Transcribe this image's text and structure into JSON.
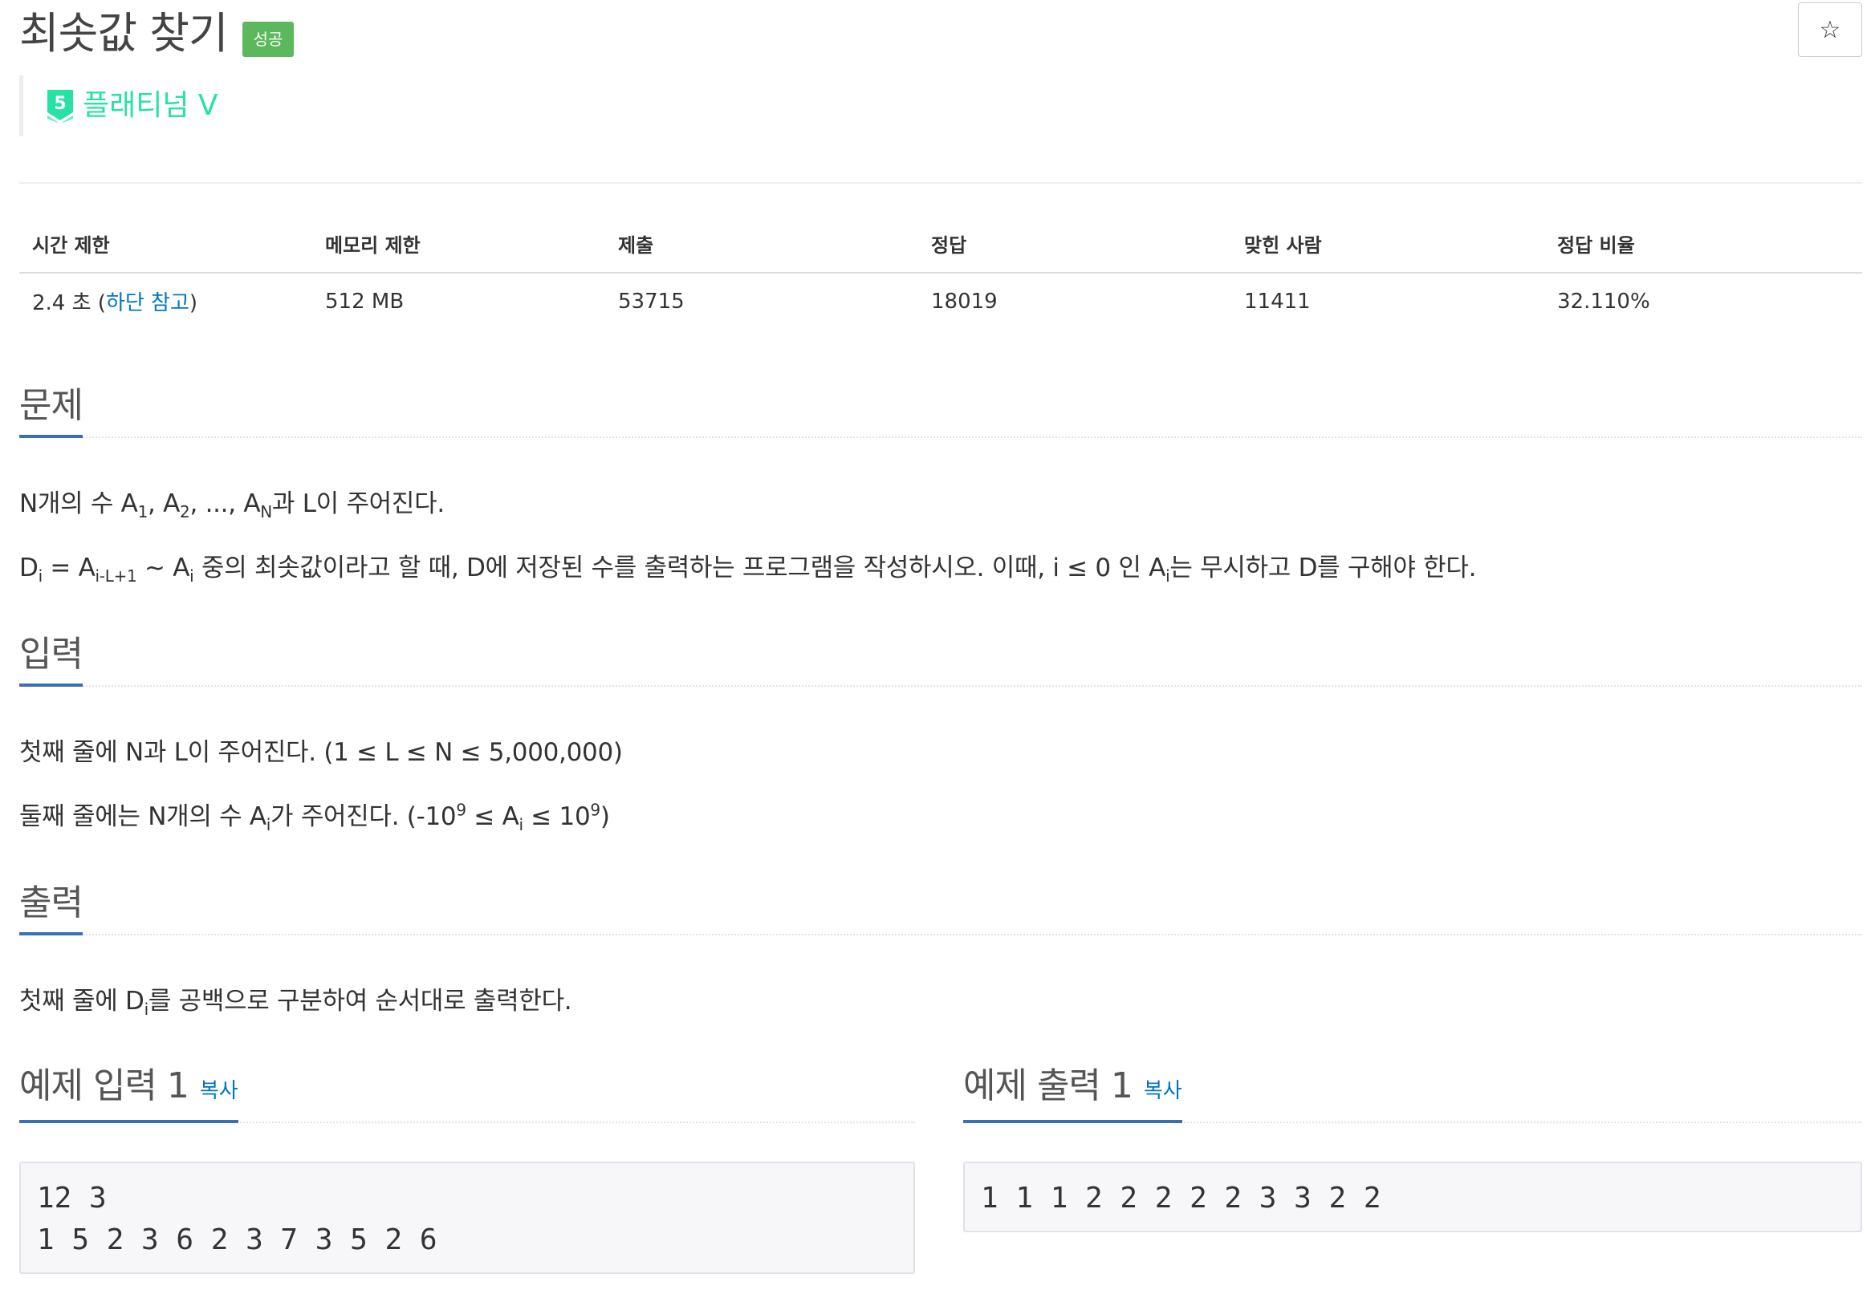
{
  "header": {
    "title": "최솟값 찾기",
    "result_badge": "성공",
    "star_glyph": "☆",
    "tier_number": "5",
    "tier_label": "플래티넘 V",
    "tier_color": "#27e2a4",
    "badge_color": "#5cb85c"
  },
  "info_table": {
    "headers": [
      "시간 제한",
      "메모리 제한",
      "제출",
      "정답",
      "맞힌 사람",
      "정답 비율"
    ],
    "time_limit_prefix": "2.4 초 (",
    "time_limit_link": "하단 참고",
    "time_limit_suffix": ")",
    "memory_limit": "512 MB",
    "submissions": "53715",
    "accepted": "18019",
    "solvers": "11411",
    "ratio": "32.110%"
  },
  "sections": {
    "problem": {
      "title": "문제",
      "line1": {
        "t1": "N개의 수 A",
        "s1": "1",
        "t2": ", A",
        "s2": "2",
        "t3": ", ..., A",
        "s3": "N",
        "t4": "과 L이 주어진다."
      },
      "line2": {
        "t1": "D",
        "s1": "i",
        "t2": " = A",
        "s2": "i-L+1",
        "t3": " ~ A",
        "s3": "i",
        "t4": " 중의 최솟값이라고 할 때, D에 저장된 수를 출력하는 프로그램을 작성하시오. 이때, i ≤ 0 인 A",
        "s4": "i",
        "t5": "는 무시하고 D를 구해야 한다."
      }
    },
    "input": {
      "title": "입력",
      "line1": "첫째 줄에 N과 L이 주어진다. (1 ≤ L ≤ N ≤ 5,000,000)",
      "line2": {
        "t1": "둘째 줄에는 N개의 수 A",
        "s1": "i",
        "t2": "가 주어진다. (-10",
        "p1": "9",
        "t3": " ≤ A",
        "s2": "i",
        "t4": " ≤ 10",
        "p2": "9",
        "t5": ")"
      }
    },
    "output": {
      "title": "출력",
      "line1": {
        "t1": "첫째 줄에 D",
        "s1": "i",
        "t2": "를 공백으로 구분하여 순서대로 출력한다."
      }
    }
  },
  "samples": {
    "input_title": "예제 입력 1",
    "output_title": "예제 출력 1",
    "copy_label": "복사",
    "input_text": "12 3\n1 5 2 3 6 2 3 7 3 5 2 6",
    "output_text": "1 1 1 2 2 2 2 2 3 3 2 2"
  }
}
